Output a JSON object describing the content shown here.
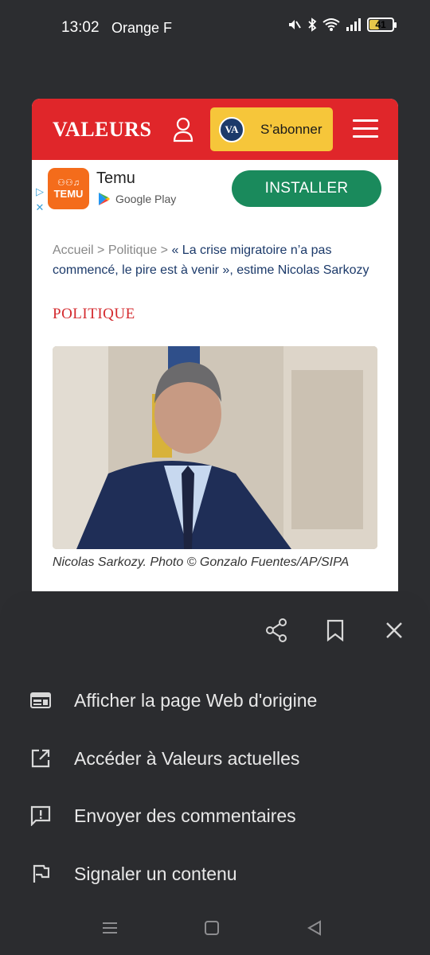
{
  "status_bar": {
    "time": "13:02",
    "carrier": "Orange F",
    "battery": "41"
  },
  "site": {
    "logo": "VALEURS",
    "subscribe_badge": "VA",
    "subscribe_label": "S’abonner"
  },
  "ad": {
    "app_name": "Temu",
    "store_label": "Google Play",
    "icon_text": "TEMU",
    "install_label": "INSTALLER"
  },
  "breadcrumb": {
    "home": "Accueil",
    "sep": ">",
    "section": "Politique",
    "current": "« La crise migratoire n’a pas commencé, le pire est à venir », estime Nicolas Sarkozy"
  },
  "article": {
    "section_label": "POLITIQUE",
    "caption": "Nicolas Sarkozy. Photo © Gonzalo Fuentes/AP/SIPA"
  },
  "sheet": {
    "menu": [
      {
        "label": "Afficher la page Web d'origine",
        "icon": "web-page-icon"
      },
      {
        "label": "Accéder à Valeurs actuelles",
        "icon": "open-external-icon"
      },
      {
        "label": "Envoyer des commentaires",
        "icon": "feedback-icon"
      },
      {
        "label": "Signaler un contenu",
        "icon": "flag-icon"
      }
    ]
  }
}
